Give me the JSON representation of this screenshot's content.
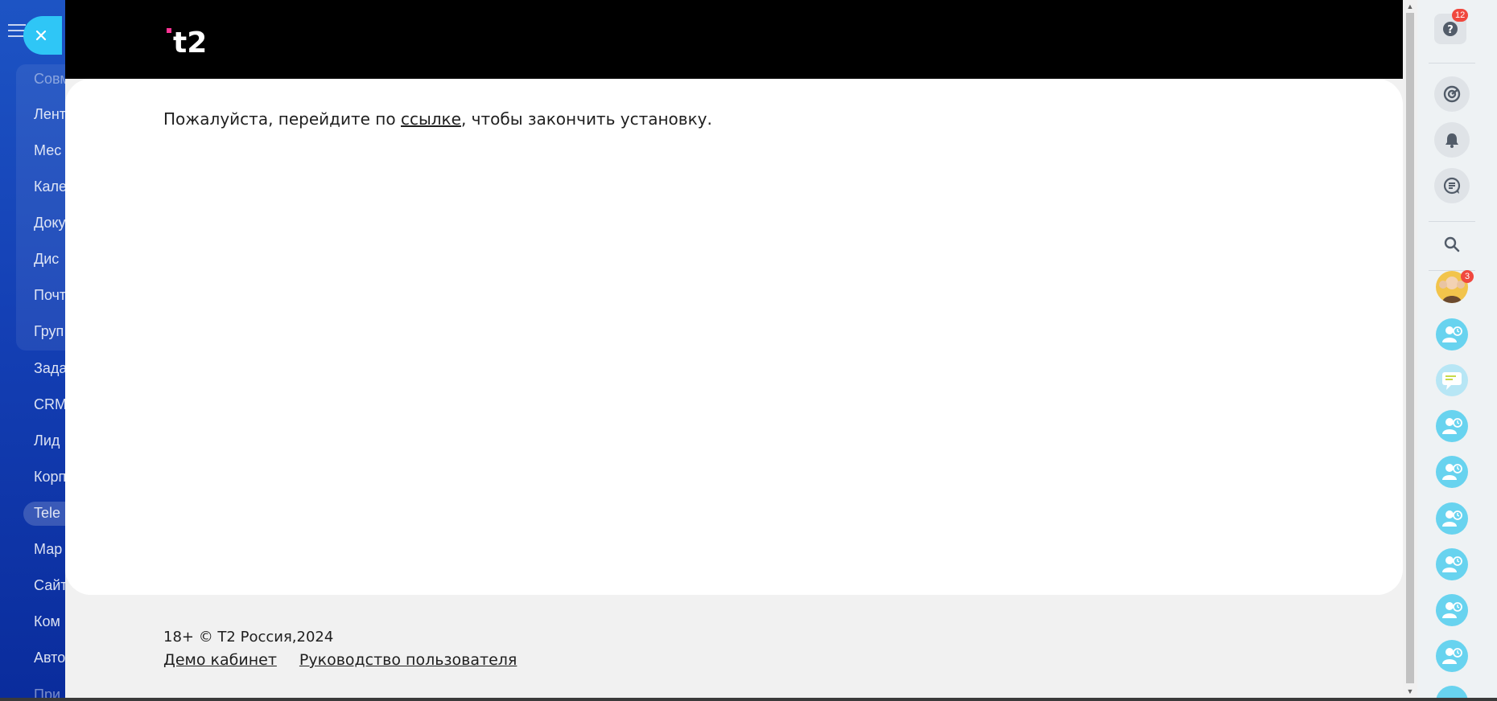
{
  "background_menu": {
    "items": [
      {
        "label": "Совм",
        "dim": true
      },
      {
        "label": "Лент"
      },
      {
        "label": "Мес"
      },
      {
        "label": "Кале"
      },
      {
        "label": "Доку"
      },
      {
        "label": "Дис"
      },
      {
        "label": "Почт"
      },
      {
        "label": "Груп"
      },
      {
        "label": "Зада"
      },
      {
        "label": "CRM"
      },
      {
        "label": "Лид"
      },
      {
        "label": "Корп"
      },
      {
        "label": "Tele"
      },
      {
        "label": "Мар"
      },
      {
        "label": "Сайт"
      },
      {
        "label": "Ком"
      },
      {
        "label": "Авто"
      },
      {
        "label": "При"
      }
    ],
    "active_item": "Tele"
  },
  "slider": {
    "logo_text": "t2",
    "message": {
      "before": "Пожалуйста, перейдите по ",
      "link": "ссылке",
      "after": ", чтобы закончить установку."
    },
    "footer": {
      "copyright": "18+ © T2 Россия,2024",
      "links": [
        "Демо кабинет",
        "Руководство пользователя"
      ]
    }
  },
  "right_panel": {
    "help_badge": "12",
    "group_badge": "3",
    "contacts_count": 8
  },
  "colors": {
    "accent": "#2fc6f6",
    "logo_dot": "#ff3495",
    "badge": "#f0483e",
    "contact": "#68d3ef"
  }
}
